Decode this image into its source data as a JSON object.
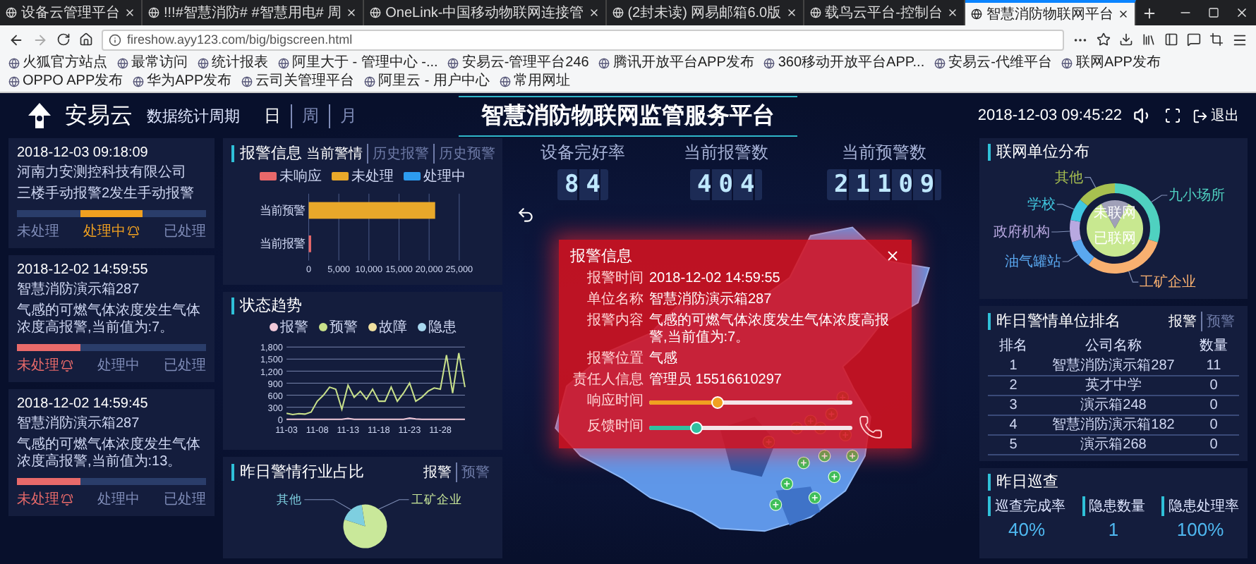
{
  "browser": {
    "tabs": [
      {
        "title": "设备云管理平台",
        "selected": false
      },
      {
        "title": "!!!#智慧消防# #智慧用电# 周",
        "selected": false
      },
      {
        "title": "OneLink-中国移动物联网连接管",
        "selected": false
      },
      {
        "title": "(2封未读) 网易邮箱6.0版",
        "selected": false
      },
      {
        "title": "载鸟云平台-控制台",
        "selected": false
      },
      {
        "title": "智慧消防物联网平台",
        "selected": true
      }
    ],
    "url": "fireshow.ayy123.com/big/bigscreen.html",
    "bookmarks": [
      "火狐官方站点",
      "最常访问",
      "统计报表",
      "阿里大于 - 管理中心 -...",
      "安易云-管理平台246",
      "腾讯开放平台APP发布",
      "360移动开放平台APP...",
      "安易云-代维平台",
      "联网APP发布",
      "OPPO APP发布",
      "华为APP发布",
      "云司关管理平台",
      "阿里云 - 用户中心",
      "常用网址"
    ]
  },
  "header": {
    "logo": "安易云",
    "period_label": "数据统计周期",
    "periods": [
      {
        "label": "日",
        "selected": true
      },
      {
        "label": "周",
        "selected": false
      },
      {
        "label": "月",
        "selected": false
      }
    ],
    "title": "智慧消防物联网监管服务平台",
    "datetime": "2018-12-03 09:45:22",
    "logout": "退出"
  },
  "alarm_cards": [
    {
      "time": "2018-12-03 09:18:09",
      "unit": "河南力安测控科技有限公司",
      "message": "三楼手动报警2发生手动报警",
      "steps": [
        {
          "label": "未处理",
          "selected": false
        },
        {
          "label": "处理中",
          "selected": true
        },
        {
          "label": "已处理",
          "selected": false
        }
      ]
    },
    {
      "time": "2018-12-02 14:59:55",
      "unit": "智慧消防演示箱287",
      "message": "气感的可燃气体浓度发生气体浓度高报警,当前值为:7。",
      "steps": [
        {
          "label": "未处理",
          "selected": true
        },
        {
          "label": "处理中",
          "selected": false
        },
        {
          "label": "已处理",
          "selected": false
        }
      ]
    },
    {
      "time": "2018-12-02 14:59:45",
      "unit": "智慧消防演示箱287",
      "message": "气感的可燃气体浓度发生气体浓度高报警,当前值为:13。",
      "steps": [
        {
          "label": "未处理",
          "selected": true
        },
        {
          "label": "处理中",
          "selected": false
        },
        {
          "label": "已处理",
          "selected": false
        }
      ]
    }
  ],
  "alarm_info": {
    "title": "报警信息",
    "tabs": [
      {
        "label": "当前警情",
        "selected": true
      },
      {
        "label": "历史报警",
        "selected": false
      },
      {
        "label": "历史预警",
        "selected": false
      }
    ],
    "chart_data": {
      "type": "bar",
      "orientation": "horizontal",
      "stacked": true,
      "categories": [
        "当前预警",
        "当前报警"
      ],
      "grid": true,
      "series": [
        {
          "name": "未响应",
          "color": "#e8686a",
          "values": [
            0,
            400
          ]
        },
        {
          "name": "未处理",
          "color": "#e8a82a",
          "values": [
            21000,
            0
          ]
        },
        {
          "name": "处理中",
          "color": "#2d9cf0",
          "values": [
            0,
            0
          ]
        }
      ],
      "xlim": [
        0,
        25000
      ],
      "xticks": [
        0,
        {
          "value": 5000,
          "label": "5,000"
        },
        {
          "value": 10000,
          "label": "10,000"
        },
        {
          "value": 15000,
          "label": "15,000"
        },
        {
          "value": 20000,
          "label": "20,000"
        },
        {
          "value": 25000,
          "label": "25,000"
        }
      ]
    }
  },
  "trend": {
    "title": "状态趋势",
    "chart_data": {
      "type": "line",
      "grid": true,
      "categories": [
        "11-03",
        null,
        null,
        null,
        null,
        "11-08",
        null,
        null,
        null,
        null,
        "11-13",
        null,
        null,
        null,
        null,
        "11-18",
        null,
        null,
        null,
        null,
        "11-23",
        null,
        null,
        null,
        null,
        "11-28",
        null,
        null,
        null,
        null
      ],
      "series": [
        {
          "name": "报警",
          "color": "#f0c8d8",
          "values": [
            0,
            0,
            0,
            0,
            0,
            0,
            0,
            0,
            0,
            0,
            20,
            0,
            0,
            0,
            0,
            0,
            0,
            0,
            0,
            0,
            30,
            10,
            0,
            0,
            0,
            0,
            0,
            0,
            0,
            0
          ]
        },
        {
          "name": "预警",
          "color": "#c8e08a",
          "values": [
            150,
            120,
            140,
            130,
            180,
            450,
            600,
            800,
            750,
            250,
            850,
            550,
            700,
            500,
            750,
            450,
            450,
            800,
            450,
            650,
            900,
            450,
            550,
            700,
            780,
            750,
            1600,
            650,
            1650,
            800
          ]
        },
        {
          "name": "故障",
          "color": "#f0e0a0",
          "values": [
            null,
            null,
            null,
            null,
            null,
            null,
            null,
            null,
            null,
            null,
            null,
            null,
            null,
            null,
            null,
            null,
            null,
            null,
            null,
            null,
            null,
            null,
            null,
            null,
            null,
            null,
            null,
            null,
            null,
            null
          ]
        },
        {
          "name": "隐患",
          "color": "#a8d8f0",
          "values": [
            null,
            null,
            null,
            null,
            null,
            null,
            null,
            null,
            null,
            null,
            null,
            null,
            null,
            null,
            null,
            null,
            null,
            null,
            null,
            null,
            null,
            null,
            null,
            null,
            null,
            null,
            null,
            null,
            null,
            null
          ]
        }
      ],
      "ylim": [
        0,
        1800
      ],
      "yticks": [
        0,
        300,
        600,
        900,
        {
          "value": 1200,
          "label": "1,200"
        },
        {
          "value": 1500,
          "label": "1,500"
        },
        {
          "value": 1800,
          "label": "1,800"
        }
      ]
    }
  },
  "industry": {
    "title": "昨日警情行业占比",
    "tabs": [
      {
        "label": "报警",
        "selected": true
      },
      {
        "label": "预警",
        "selected": false
      }
    ],
    "slices": [
      {
        "label": "其他",
        "color": "#7ecfe0"
      },
      {
        "label": "工矿企业",
        "color": "#c9e89a"
      }
    ]
  },
  "counters": [
    {
      "label": "设备完好率",
      "value": "84"
    },
    {
      "label": "当前报警数",
      "value": "404"
    },
    {
      "label": "当前预警数",
      "value": "21109"
    }
  ],
  "popup": {
    "title": "报警信息",
    "fields": [
      {
        "label": "报警时间",
        "value": "2018-12-02 14:59:55"
      },
      {
        "label": "单位名称",
        "value": "智慧消防演示箱287"
      },
      {
        "label": "报警内容",
        "value": "气感的可燃气体浓度发生气体浓度高报警,当前值为:7。"
      },
      {
        "label": "报警位置",
        "value": "气感"
      },
      {
        "label": "责任人信息",
        "value": "管理员  15516610297"
      }
    ],
    "sliders": [
      {
        "label": "响应时间",
        "level": 0.33,
        "color": "#f0a020"
      },
      {
        "label": "反馈时间",
        "level": 0.23,
        "color": "#30c0a0"
      }
    ]
  },
  "network": {
    "title": "联网单位分布",
    "segments": [
      {
        "label": "其他",
        "color": "#a8c050"
      },
      {
        "label": "学校",
        "color": "#40c8e0"
      },
      {
        "label": "九小场所",
        "color": "#4fd1c0"
      },
      {
        "label": "政府机构",
        "color": "#b8a8e0"
      },
      {
        "label": "油气罐站",
        "color": "#5aa8f0"
      },
      {
        "label": "工矿企业",
        "color": "#f8b070"
      }
    ],
    "inner": [
      {
        "label": "未联网",
        "color": "#a0a0b8"
      },
      {
        "label": "已联网",
        "color": "#c8e890"
      }
    ]
  },
  "ranking": {
    "title": "昨日警情单位排名",
    "tabs": [
      {
        "label": "报警",
        "selected": true
      },
      {
        "label": "预警",
        "selected": false
      }
    ],
    "columns": [
      "排名",
      "公司名称",
      "数量"
    ],
    "rows": [
      [
        "1",
        "智慧消防演示箱287",
        "11"
      ],
      [
        "2",
        "英才中学",
        "0"
      ],
      [
        "3",
        "演示箱248",
        "0"
      ],
      [
        "4",
        "智慧消防演示箱182",
        "0"
      ],
      [
        "5",
        "演示箱268",
        "0"
      ]
    ]
  },
  "patrol": {
    "title": "昨日巡查",
    "metrics": [
      {
        "label": "巡查完成率",
        "value": "40%"
      },
      {
        "label": "隐患数量",
        "value": "1"
      },
      {
        "label": "隐患处理率",
        "value": "100%"
      }
    ]
  }
}
